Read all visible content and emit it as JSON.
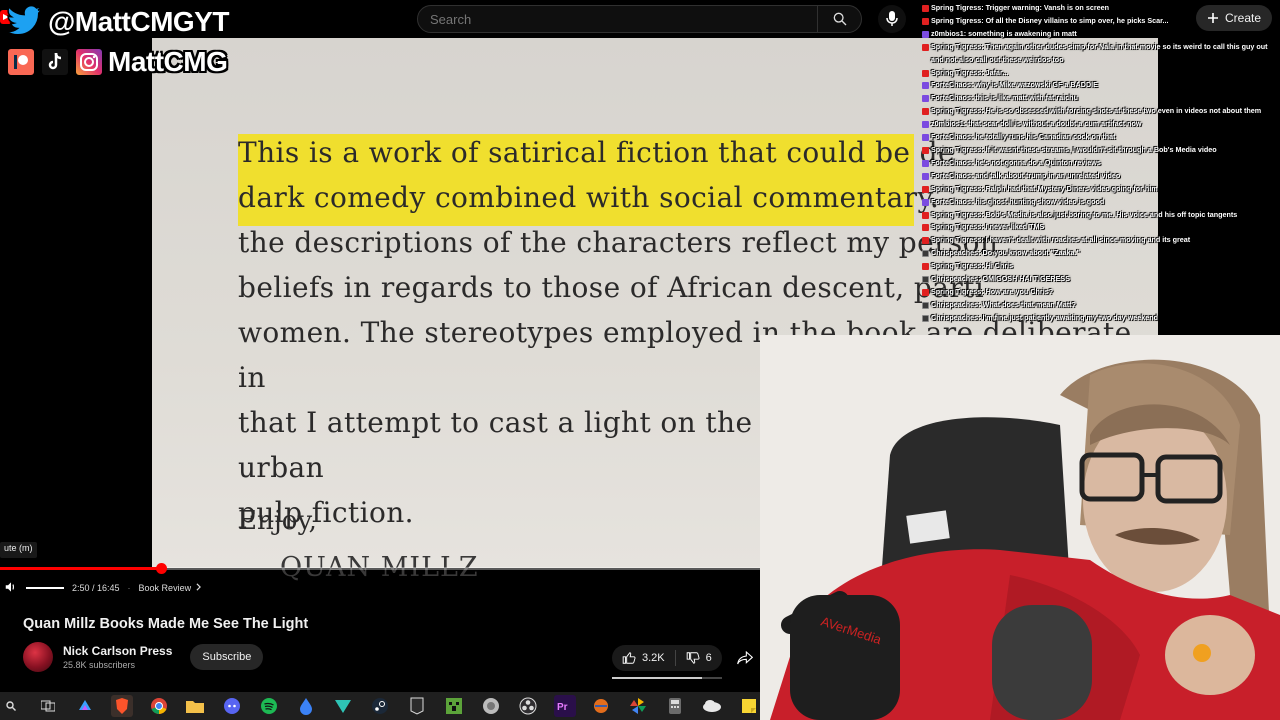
{
  "search": {
    "placeholder": "Search"
  },
  "header": {
    "create_label": "Create"
  },
  "social": {
    "twitter_handle": "@MattCMGYT",
    "other_handle": "MattCMG"
  },
  "book_page": {
    "highlighted_line_1": "This is a work of satirical fiction that could be de",
    "highlighted_line_2": "dark comedy combined with social commentary.",
    "line_3": "the descriptions of the characters reflect my person",
    "line_4": "beliefs in regards to those of African descent, parti",
    "line_5": "women. The stereotypes employed in the book are deliberate in",
    "line_6": "that I attempt to cast a light on the state of contemporary urban",
    "line_7": "pulp fiction.",
    "closing": "Enjoy,",
    "signature": "QUAN MILLZ"
  },
  "player": {
    "mute_tooltip": "ute (m)",
    "time_display": "2:50 / 16:45",
    "chapter_label": "Book Review",
    "progress_fraction": 0.175
  },
  "video": {
    "title": "Quan Millz Books Made Me See The Light",
    "channel_name": "Nick Carlson Press",
    "subscriber_count": "25.8K subscribers",
    "subscribe_label": "Subscribe",
    "like_count": "3.2K",
    "dislike_count": "6",
    "like_ratio": 0.82
  },
  "webcam": {
    "brand_text": "AVerMedia"
  },
  "chat": [
    {
      "badge": "yt",
      "text": "Spring Tigress: Trigger warning: Vansh is on screen"
    },
    {
      "badge": "yt",
      "text": "Spring Tigress: Of all the Disney villains to simp over, he picks Scar..."
    },
    {
      "badge": "tw",
      "text": "z0mbios1: something is awakening in matt"
    },
    {
      "badge": "yt",
      "text": "Spring Tigress: Then again other dudes simp for Nala in that movie so its weird to call this guy out and not also call out these weirdos too",
      "wrap": true
    },
    {
      "badge": "yt",
      "text": "Spring Tigress: Jafar..."
    },
    {
      "badge": "tw",
      "text": "ForteChaos: why is Mike wazowski GF a BADDIE"
    },
    {
      "badge": "tw",
      "text": "ForteChaos: this is like matt with fat raichu"
    },
    {
      "badge": "yt",
      "text": "Spring Tigress: He is so obsessed with forcing shots at these two even in videos not about them"
    },
    {
      "badge": "tw",
      "text": "z0mbios1: that scar doll is without a doubt a cum artifact now"
    },
    {
      "badge": "tw",
      "text": "ForteChaos: he totally runs his Canadian cock on that"
    },
    {
      "badge": "yt",
      "text": "Spring Tigress: If it wasnt these streams, I wouldn't sit through a Bob's Media video"
    },
    {
      "badge": "tw",
      "text": "ForteChaos: he's not gonna do a Quinton reviews"
    },
    {
      "badge": "tw",
      "text": "ForteChaos: and talk about trump in an unrelated video"
    },
    {
      "badge": "yt",
      "text": "Spring Tigress: Ralph had that Mystery Diners video going for him"
    },
    {
      "badge": "tw",
      "text": "ForteChaos: his ghost hunting show video is good"
    },
    {
      "badge": "yt",
      "text": "Spring Tigress: Bob's Media is also just boring to me. His voice and his off topic tangents"
    },
    {
      "badge": "yt",
      "text": "Spring Tigress: I never liked TMS"
    },
    {
      "badge": "yt",
      "text": "Spring Tigress: I haven't dealt with roaches at all since moving and its great"
    },
    {
      "badge": "mod",
      "text": "Chrispeaches: Do you know about \"Zaaka.\""
    },
    {
      "badge": "yt",
      "text": "Spring Tigress: Hi Chris"
    },
    {
      "badge": "mod",
      "text": "Chrispeaches: OMIGOSH HAI TIGERESS"
    },
    {
      "badge": "yt",
      "text": "Spring Tigress: How are you Chris?"
    },
    {
      "badge": "mod",
      "text": "Chrispeaches: What does that mean Matt?"
    },
    {
      "badge": "mod",
      "text": "Chrispeaches: I'm fine just patiently awaiting my two day weekend"
    }
  ],
  "icons": {
    "search": "search-icon",
    "mic": "mic-icon",
    "create": "plus-icon",
    "twitter": "twitter-icon",
    "patreon": "patreon-icon",
    "tiktok": "tiktok-icon",
    "instagram": "instagram-icon",
    "like": "thumbs-up-icon",
    "dislike": "thumbs-down-icon",
    "share": "share-icon",
    "volume": "volume-icon"
  },
  "colors": {
    "accent_red": "#ff0000",
    "highlight_yellow": "#f0df2e",
    "chat_yt_badge": "#e02020",
    "chat_tw_badge": "#7b4be0"
  }
}
